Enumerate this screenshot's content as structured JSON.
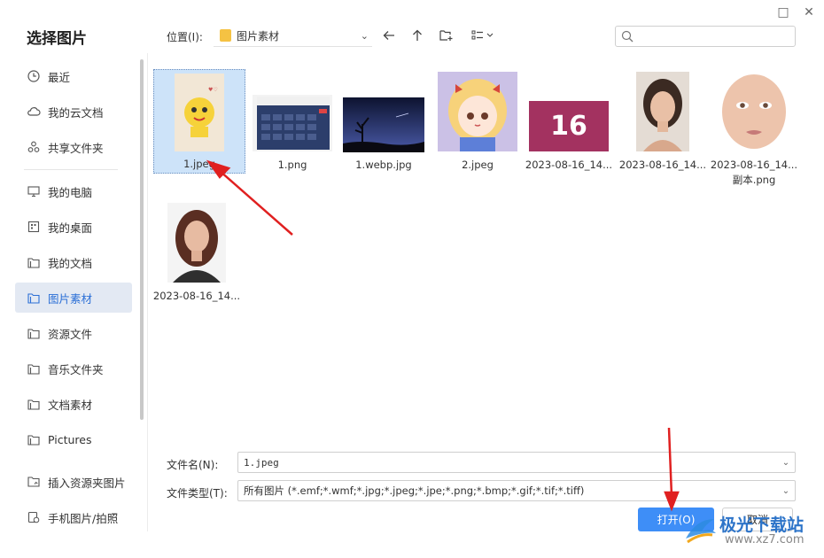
{
  "dialog": {
    "title": "选择图片"
  },
  "window_controls": {
    "maximize": "□",
    "close": "✕"
  },
  "sidebar": {
    "items": [
      {
        "label": "最近",
        "icon": "clock-icon"
      },
      {
        "label": "我的云文档",
        "icon": "cloud-icon"
      },
      {
        "label": "共享文件夹",
        "icon": "share-icon"
      },
      {
        "label": "我的电脑",
        "icon": "monitor-icon"
      },
      {
        "label": "我的桌面",
        "icon": "desktop-icon"
      },
      {
        "label": "我的文档",
        "icon": "folder-icon"
      },
      {
        "label": "图片素材",
        "icon": "folder-icon",
        "active": true
      },
      {
        "label": "资源文件",
        "icon": "folder-icon"
      },
      {
        "label": "音乐文件夹",
        "icon": "folder-icon"
      },
      {
        "label": "文档素材",
        "icon": "folder-icon"
      },
      {
        "label": "Pictures",
        "icon": "folder-icon"
      },
      {
        "label": "插入资源夹图片",
        "icon": "image-folder-icon"
      },
      {
        "label": "手机图片/拍照",
        "icon": "phone-image-icon"
      }
    ]
  },
  "toolbar": {
    "location_label": "位置(I):",
    "location_value": "图片素材",
    "search_placeholder": ""
  },
  "files": [
    {
      "name": "1.jpeg",
      "selected": true
    },
    {
      "name": "1.png"
    },
    {
      "name": "1.webp.jpg"
    },
    {
      "name": "2.jpeg"
    },
    {
      "name": "2023-08-16_14...",
      "thumb_text": "16"
    },
    {
      "name": "2023-08-16_14..."
    },
    {
      "name": "2023-08-16_14...",
      "name_line2": "副本.png"
    },
    {
      "name": "2023-08-16_14..."
    }
  ],
  "form": {
    "filename_label": "文件名(N):",
    "filename_value": "1.jpeg",
    "filetype_label": "文件类型(T):",
    "filetype_value": "所有图片 (*.emf;*.wmf;*.jpg;*.jpeg;*.jpe;*.png;*.bmp;*.gif;*.tif;*.tiff)"
  },
  "buttons": {
    "open": "打开(O)",
    "cancel": "取消"
  },
  "watermark": {
    "text": "极光下载站",
    "url": "www.xz7.com"
  },
  "colors": {
    "accent": "#3e8ef7",
    "active_bg": "#e3e9f3",
    "selected_bg": "#cde3f9",
    "arrow": "#e02020"
  }
}
